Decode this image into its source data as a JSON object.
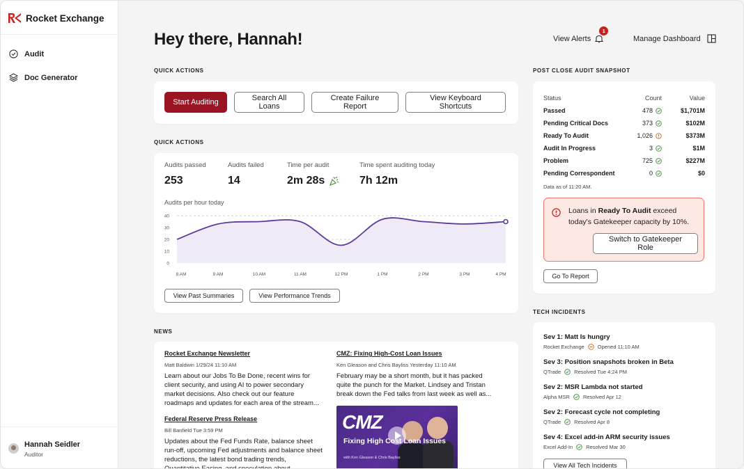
{
  "brand": {
    "name": "Rocket Exchange",
    "color": "#c8201c"
  },
  "sidebar": {
    "items": [
      {
        "label": "Audit",
        "icon": "check-circle-icon"
      },
      {
        "label": "Doc Generator",
        "icon": "layers-icon"
      }
    ],
    "user": {
      "name": "Hannah Seidler",
      "role": "Auditor"
    }
  },
  "header": {
    "greeting": "Hey there, Hannah!",
    "alerts_label": "View Alerts",
    "alerts_count": "1",
    "manage_label": "Manage Dashboard"
  },
  "quick_actions": {
    "label": "QUICK ACTIONS",
    "buttons": [
      "Start Auditing",
      "Search All Loans",
      "Create Failure Report",
      "View Keyboard Shortcuts"
    ]
  },
  "stats": {
    "label": "QUICK ACTIONS",
    "items": [
      {
        "label": "Audits passed",
        "value": "253"
      },
      {
        "label": "Audits failed",
        "value": "14"
      },
      {
        "label": "Time per audit",
        "value": "2m 28s"
      },
      {
        "label": "Time spent auditing today",
        "value": "7h 12m"
      }
    ],
    "chart_title": "Audits per hour today",
    "buttons": [
      "View Past Summaries",
      "View Performance Trends"
    ]
  },
  "chart_data": {
    "type": "area",
    "title": "Audits per hour today",
    "x": [
      "8 AM",
      "9 AM",
      "10 AM",
      "11 AM",
      "12 PM",
      "1 PM",
      "2 PM",
      "3 PM",
      "4 PM"
    ],
    "values": [
      20,
      33,
      35,
      35,
      15,
      37,
      35,
      33,
      35
    ],
    "yticks": [
      0,
      10,
      20,
      30,
      40
    ],
    "ylim": [
      0,
      40
    ],
    "reference_lines": [
      40,
      20
    ],
    "line_color": "#5b3a9e",
    "fill_color": "#eeebf6"
  },
  "news": {
    "label": "NEWS",
    "articles": [
      {
        "title": "Rocket Exchange Newsletter",
        "meta": "Matt Baldwin   1/29/24 11:10 AM",
        "body": "Learn about our Jobs To Be Done, recent wins for client security, and using AI to power secondary market decisions. Also check out our feature roadmaps and updates for each area of the stream..."
      },
      {
        "title": "Federal Reserve Press Release",
        "meta": "Bill Banfield   Tue 3:59 PM",
        "body": "Updates about the Fed Funds Rate, balance sheet run-off, upcoming Fed adjustments and balance sheet reductions, the latest bond trading trends, Quantitative Easing, and speculation about..."
      },
      {
        "title": "CMZ: Fixing High-Cost Loan Issues",
        "meta": "Ken Gleason and Chris Bayliss   Yesterday 11:10 AM",
        "body": "February may be a short month, but it has packed quite the punch for the Market. Lindsey and Tristan break down the Fed talks from last week as well as..."
      }
    ],
    "thumbnail": {
      "logo": "CMZ",
      "headline": "Fixing High Cost Loan Issues",
      "byline": "with Ken Gleason & Chris Bayliss"
    }
  },
  "snapshot": {
    "label": "POST CLOSE AUDIT SNAPSHOT",
    "headers": [
      "Status",
      "Count",
      "Value"
    ],
    "rows": [
      {
        "status": "Passed",
        "count": "478",
        "icon": "check-circle-icon",
        "value": "$1,701M"
      },
      {
        "status": "Pending Critical Docs",
        "count": "373",
        "icon": "check-circle-icon",
        "value": "$102M"
      },
      {
        "status": "Ready To Audit",
        "count": "1,026",
        "icon": "warning-circle-icon",
        "value": "$373M"
      },
      {
        "status": "Audit In Progress",
        "count": "3",
        "icon": "check-circle-icon",
        "value": "$1M"
      },
      {
        "status": "Problem",
        "count": "725",
        "icon": "check-circle-icon",
        "value": "$227M"
      },
      {
        "status": "Pending Correspondent",
        "count": "0",
        "icon": "check-circle-icon",
        "value": "$0"
      }
    ],
    "note": "Data as of 11:20 AM.",
    "alert": {
      "pre": "Loans in ",
      "bold": "Ready To Audit",
      "post": " exceed today's Gatekeeper capacity by 10%.",
      "button": "Switch to Gatekeeper Role"
    },
    "report_button": "Go To Report"
  },
  "incidents": {
    "label": "TECH INCIDENTS",
    "items": [
      {
        "title": "Sev 1: Matt Is hungry",
        "source": "Rocket Exchange",
        "status": "Opened 11:10 AM",
        "state": "open"
      },
      {
        "title": "Sev 3: Position snapshots broken in Beta",
        "source": "QTrade",
        "status": "Resolved Tue 4:24 PM",
        "state": "resolved"
      },
      {
        "title": "Sev 2: MSR Lambda not started",
        "source": "Alpha MSR",
        "status": "Resolved Apr 12",
        "state": "resolved"
      },
      {
        "title": "Sev 2: Forecast cycle not completing",
        "source": "QTrade",
        "status": "Resolved Apr 8",
        "state": "resolved"
      },
      {
        "title": "Sev 4: Excel add-in ARM security issues",
        "source": "Excel Add-In",
        "status": "Resolved Mar 30",
        "state": "resolved"
      }
    ],
    "button": "View All Tech Incidents"
  },
  "colors": {
    "success": "#3a8a3a",
    "warning": "#d9651a",
    "accent": "#9b1424"
  }
}
